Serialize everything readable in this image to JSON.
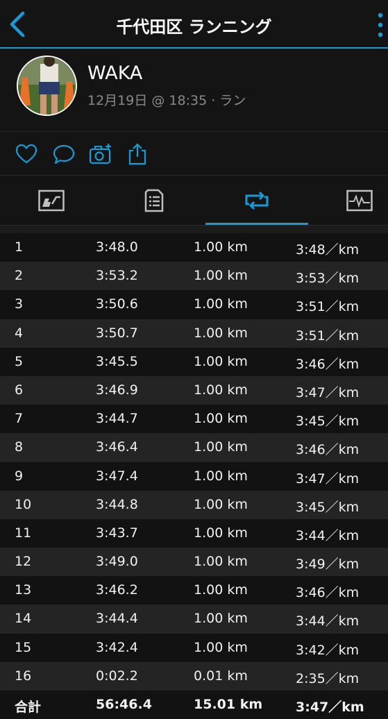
{
  "header": {
    "title": "千代田区 ランニング"
  },
  "activity": {
    "user_name": "WAKA",
    "meta": "12月19日 @ 18:35 · ラン"
  },
  "actions": [
    "heart-icon",
    "comment-icon",
    "camera-add-icon",
    "share-icon"
  ],
  "tabs": [
    {
      "icon": "overview-tab-icon",
      "active": false
    },
    {
      "icon": "details-tab-icon",
      "active": false
    },
    {
      "icon": "laps-tab-icon",
      "active": true
    },
    {
      "icon": "charts-tab-icon",
      "active": false
    }
  ],
  "laps": [
    {
      "lap": "1",
      "time": "3:48.0",
      "distance": "1.00 km",
      "pace": "3:48／km"
    },
    {
      "lap": "2",
      "time": "3:53.2",
      "distance": "1.00 km",
      "pace": "3:53／km"
    },
    {
      "lap": "3",
      "time": "3:50.6",
      "distance": "1.00 km",
      "pace": "3:51／km"
    },
    {
      "lap": "4",
      "time": "3:50.7",
      "distance": "1.00 km",
      "pace": "3:51／km"
    },
    {
      "lap": "5",
      "time": "3:45.5",
      "distance": "1.00 km",
      "pace": "3:46／km"
    },
    {
      "lap": "6",
      "time": "3:46.9",
      "distance": "1.00 km",
      "pace": "3:47／km"
    },
    {
      "lap": "7",
      "time": "3:44.7",
      "distance": "1.00 km",
      "pace": "3:45／km"
    },
    {
      "lap": "8",
      "time": "3:46.4",
      "distance": "1.00 km",
      "pace": "3:46／km"
    },
    {
      "lap": "9",
      "time": "3:47.4",
      "distance": "1.00 km",
      "pace": "3:47／km"
    },
    {
      "lap": "10",
      "time": "3:44.8",
      "distance": "1.00 km",
      "pace": "3:45／km"
    },
    {
      "lap": "11",
      "time": "3:43.7",
      "distance": "1.00 km",
      "pace": "3:44／km"
    },
    {
      "lap": "12",
      "time": "3:49.0",
      "distance": "1.00 km",
      "pace": "3:49／km"
    },
    {
      "lap": "13",
      "time": "3:46.2",
      "distance": "1.00 km",
      "pace": "3:46／km"
    },
    {
      "lap": "14",
      "time": "3:44.4",
      "distance": "1.00 km",
      "pace": "3:44／km"
    },
    {
      "lap": "15",
      "time": "3:42.4",
      "distance": "1.00 km",
      "pace": "3:42／km"
    },
    {
      "lap": "16",
      "time": "0:02.2",
      "distance": "0.01 km",
      "pace": "2:35／km"
    }
  ],
  "total": {
    "lap": "合計",
    "time": "56:46.4",
    "distance": "15.01 km",
    "pace": "3:47／km"
  },
  "colors": {
    "accent": "#1a9ad6",
    "background": "#121212",
    "row_alt": "#242424",
    "meta_text": "#8a8a8a"
  }
}
